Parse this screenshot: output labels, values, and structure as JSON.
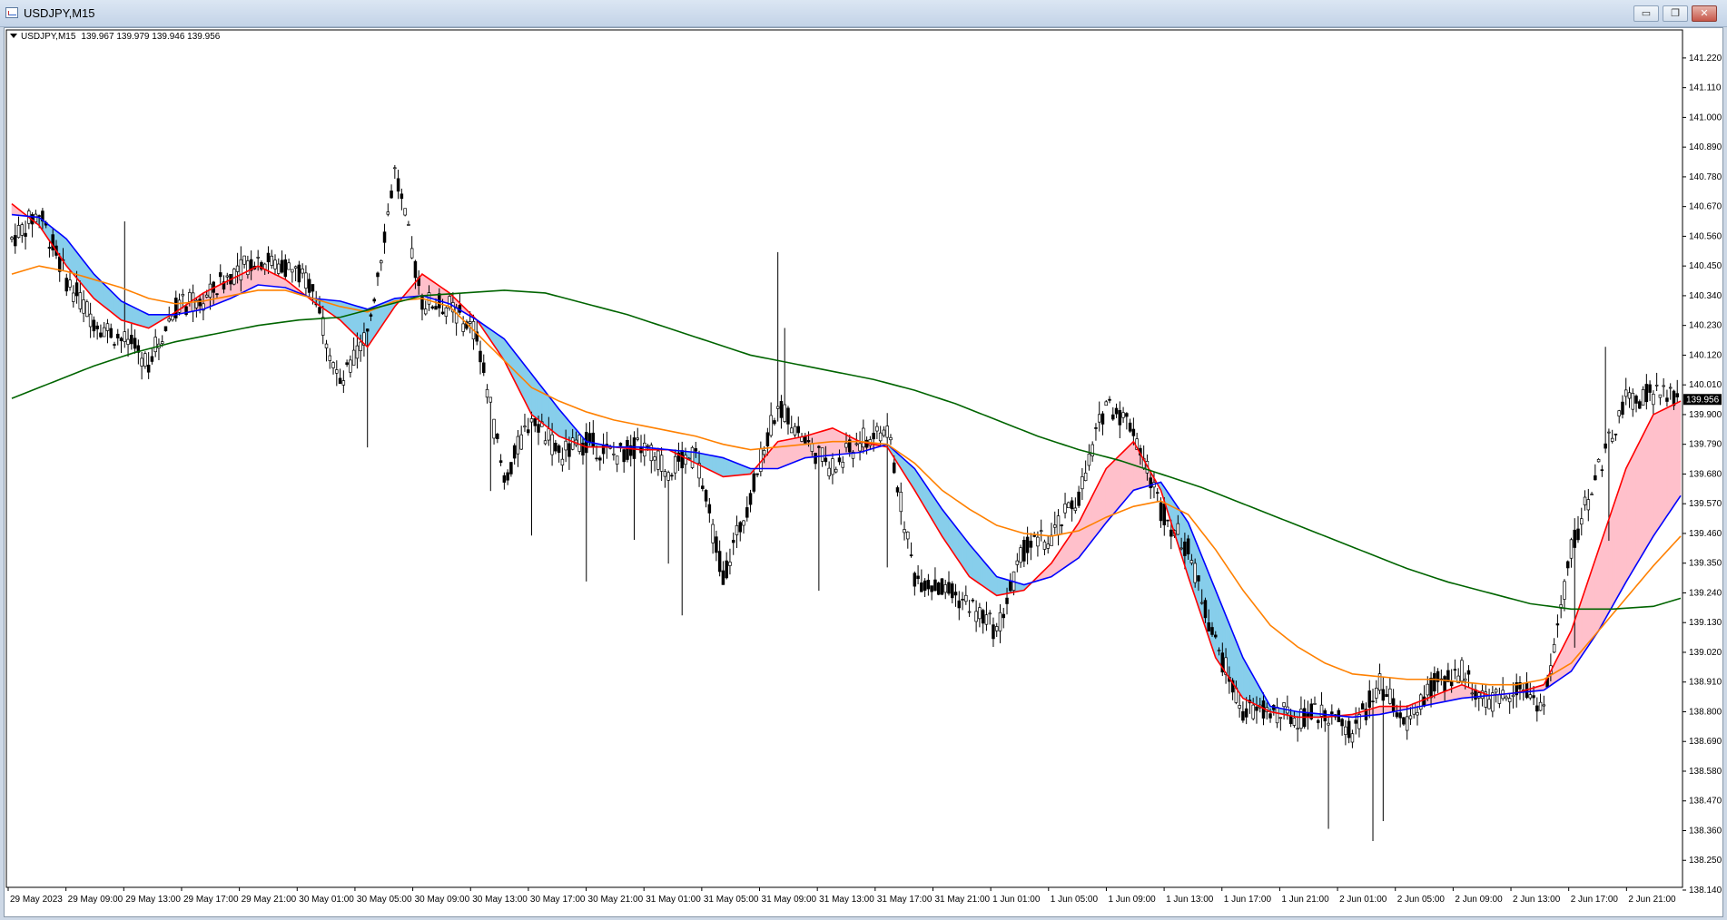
{
  "window": {
    "title": "USDJPY,M15"
  },
  "window_buttons": [
    {
      "name": "minimize-button",
      "glyph": "▭"
    },
    {
      "name": "restore-button",
      "glyph": "❐"
    },
    {
      "name": "close-button",
      "glyph": "✕"
    }
  ],
  "info": {
    "symbol": "USDJPY,M15",
    "ohlc": "139.967 139.979 139.946 139.956"
  },
  "colors": {
    "fast_ma": "#ff0000",
    "slow_ma": "#0000ff",
    "ma_orange": "#ff8000",
    "ma_green": "#006400",
    "bull_cloud": "#87ceeb",
    "bear_cloud": "#ffc0cb",
    "candles": "#000000"
  },
  "chart_data": {
    "type": "candlestick",
    "symbol": "USDJPY",
    "timeframe": "M15",
    "ylim": [
      138.14,
      141.27
    ],
    "y_ticks": [
      "141.220",
      "141.110",
      "141.000",
      "140.890",
      "140.780",
      "140.670",
      "140.560",
      "140.450",
      "140.340",
      "140.230",
      "140.120",
      "140.010",
      "139.900",
      "139.790",
      "139.680",
      "139.570",
      "139.460",
      "139.350",
      "139.240",
      "139.130",
      "139.020",
      "138.910",
      "138.800",
      "138.690",
      "138.580",
      "138.470",
      "138.360",
      "138.250",
      "138.140"
    ],
    "x_ticks": [
      "29 May 2023",
      "29 May 09:00",
      "29 May 13:00",
      "29 May 17:00",
      "29 May 21:00",
      "30 May 01:00",
      "30 May 05:00",
      "30 May 09:00",
      "30 May 13:00",
      "30 May 17:00",
      "30 May 21:00",
      "31 May 01:00",
      "31 May 05:00",
      "31 May 09:00",
      "31 May 13:00",
      "31 May 17:00",
      "31 May 21:00",
      "1 Jun 01:00",
      "1 Jun 05:00",
      "1 Jun 09:00",
      "1 Jun 13:00",
      "1 Jun 17:00",
      "1 Jun 21:00",
      "2 Jun 01:00",
      "2 Jun 05:00",
      "2 Jun 09:00",
      "2 Jun 13:00",
      "2 Jun 17:00",
      "2 Jun 21:00"
    ],
    "current_price": "139.956",
    "price_path": [
      [
        0,
        140.55
      ],
      [
        8,
        140.65
      ],
      [
        16,
        140.4
      ],
      [
        24,
        140.25
      ],
      [
        32,
        140.18
      ],
      [
        40,
        140.1
      ],
      [
        48,
        140.3
      ],
      [
        56,
        140.32
      ],
      [
        64,
        140.42
      ],
      [
        72,
        140.48
      ],
      [
        80,
        140.45
      ],
      [
        88,
        140.38
      ],
      [
        96,
        140.0
      ],
      [
        104,
        140.2
      ],
      [
        112,
        140.8
      ],
      [
        120,
        140.32
      ],
      [
        128,
        140.3
      ],
      [
        136,
        140.2
      ],
      [
        144,
        139.65
      ],
      [
        152,
        139.9
      ],
      [
        160,
        139.75
      ],
      [
        168,
        139.8
      ],
      [
        176,
        139.75
      ],
      [
        184,
        139.78
      ],
      [
        192,
        139.7
      ],
      [
        200,
        139.75
      ],
      [
        208,
        139.3
      ],
      [
        216,
        139.6
      ],
      [
        224,
        139.95
      ],
      [
        232,
        139.8
      ],
      [
        240,
        139.7
      ],
      [
        248,
        139.8
      ],
      [
        256,
        139.85
      ],
      [
        264,
        139.3
      ],
      [
        272,
        139.25
      ],
      [
        280,
        139.2
      ],
      [
        288,
        139.1
      ],
      [
        296,
        139.4
      ],
      [
        304,
        139.45
      ],
      [
        312,
        139.6
      ],
      [
        320,
        139.95
      ],
      [
        328,
        139.85
      ],
      [
        336,
        139.55
      ],
      [
        344,
        139.4
      ],
      [
        352,
        139.05
      ],
      [
        360,
        138.8
      ],
      [
        368,
        138.8
      ],
      [
        376,
        138.78
      ],
      [
        384,
        138.8
      ],
      [
        392,
        138.72
      ],
      [
        400,
        138.9
      ],
      [
        408,
        138.75
      ],
      [
        416,
        138.9
      ],
      [
        424,
        138.95
      ],
      [
        432,
        138.82
      ],
      [
        440,
        138.9
      ],
      [
        448,
        138.82
      ],
      [
        456,
        139.4
      ],
      [
        464,
        139.7
      ],
      [
        472,
        139.95
      ],
      [
        480,
        139.98
      ],
      [
        488,
        139.96
      ]
    ],
    "series": [
      {
        "name": "fast_ma",
        "color": "#ff0000",
        "values": [
          [
            0,
            140.68
          ],
          [
            8,
            140.6
          ],
          [
            16,
            140.45
          ],
          [
            24,
            140.33
          ],
          [
            32,
            140.25
          ],
          [
            40,
            140.22
          ],
          [
            48,
            140.28
          ],
          [
            56,
            140.35
          ],
          [
            64,
            140.4
          ],
          [
            72,
            140.45
          ],
          [
            80,
            140.4
          ],
          [
            88,
            140.32
          ],
          [
            96,
            140.25
          ],
          [
            104,
            140.15
          ],
          [
            112,
            140.3
          ],
          [
            120,
            140.42
          ],
          [
            128,
            140.35
          ],
          [
            136,
            140.25
          ],
          [
            144,
            140.1
          ],
          [
            152,
            139.9
          ],
          [
            160,
            139.82
          ],
          [
            168,
            139.78
          ],
          [
            176,
            139.78
          ],
          [
            184,
            139.77
          ],
          [
            192,
            139.77
          ],
          [
            200,
            139.72
          ],
          [
            208,
            139.67
          ],
          [
            216,
            139.68
          ],
          [
            224,
            139.8
          ],
          [
            232,
            139.82
          ],
          [
            240,
            139.85
          ],
          [
            248,
            139.8
          ],
          [
            256,
            139.78
          ],
          [
            264,
            139.62
          ],
          [
            272,
            139.45
          ],
          [
            280,
            139.3
          ],
          [
            288,
            139.23
          ],
          [
            296,
            139.25
          ],
          [
            304,
            139.35
          ],
          [
            312,
            139.5
          ],
          [
            320,
            139.7
          ],
          [
            328,
            139.8
          ],
          [
            336,
            139.62
          ],
          [
            344,
            139.3
          ],
          [
            352,
            139.0
          ],
          [
            360,
            138.85
          ],
          [
            368,
            138.8
          ],
          [
            376,
            138.78
          ],
          [
            384,
            138.78
          ],
          [
            392,
            138.79
          ],
          [
            400,
            138.82
          ],
          [
            408,
            138.82
          ],
          [
            416,
            138.86
          ],
          [
            424,
            138.9
          ],
          [
            432,
            138.86
          ],
          [
            440,
            138.87
          ],
          [
            448,
            138.9
          ],
          [
            456,
            139.1
          ],
          [
            464,
            139.4
          ],
          [
            472,
            139.7
          ],
          [
            480,
            139.9
          ],
          [
            488,
            139.95
          ]
        ]
      },
      {
        "name": "slow_ma",
        "color": "#0000ff",
        "values": [
          [
            0,
            140.64
          ],
          [
            8,
            140.63
          ],
          [
            16,
            140.55
          ],
          [
            24,
            140.42
          ],
          [
            32,
            140.32
          ],
          [
            40,
            140.27
          ],
          [
            48,
            140.27
          ],
          [
            56,
            140.29
          ],
          [
            64,
            140.33
          ],
          [
            72,
            140.38
          ],
          [
            80,
            140.37
          ],
          [
            88,
            140.33
          ],
          [
            96,
            140.32
          ],
          [
            104,
            140.29
          ],
          [
            112,
            140.33
          ],
          [
            120,
            140.34
          ],
          [
            128,
            140.31
          ],
          [
            136,
            140.25
          ],
          [
            144,
            140.18
          ],
          [
            152,
            140.05
          ],
          [
            160,
            139.92
          ],
          [
            168,
            139.8
          ],
          [
            176,
            139.78
          ],
          [
            184,
            139.78
          ],
          [
            192,
            139.77
          ],
          [
            200,
            139.76
          ],
          [
            208,
            139.74
          ],
          [
            216,
            139.7
          ],
          [
            224,
            139.7
          ],
          [
            232,
            139.74
          ],
          [
            240,
            139.75
          ],
          [
            248,
            139.76
          ],
          [
            256,
            139.79
          ],
          [
            264,
            139.7
          ],
          [
            272,
            139.55
          ],
          [
            280,
            139.42
          ],
          [
            288,
            139.3
          ],
          [
            296,
            139.27
          ],
          [
            304,
            139.3
          ],
          [
            312,
            139.37
          ],
          [
            320,
            139.5
          ],
          [
            328,
            139.62
          ],
          [
            336,
            139.65
          ],
          [
            344,
            139.5
          ],
          [
            352,
            139.25
          ],
          [
            360,
            139.0
          ],
          [
            368,
            138.82
          ],
          [
            376,
            138.8
          ],
          [
            384,
            138.79
          ],
          [
            392,
            138.78
          ],
          [
            400,
            138.79
          ],
          [
            408,
            138.81
          ],
          [
            416,
            138.83
          ],
          [
            424,
            138.85
          ],
          [
            432,
            138.86
          ],
          [
            440,
            138.87
          ],
          [
            448,
            138.88
          ],
          [
            456,
            138.95
          ],
          [
            464,
            139.1
          ],
          [
            472,
            139.28
          ],
          [
            480,
            139.45
          ],
          [
            488,
            139.6
          ]
        ]
      },
      {
        "name": "ma_orange",
        "color": "#ff8000",
        "values": [
          [
            0,
            140.42
          ],
          [
            8,
            140.45
          ],
          [
            16,
            140.43
          ],
          [
            24,
            140.4
          ],
          [
            32,
            140.37
          ],
          [
            40,
            140.33
          ],
          [
            48,
            140.31
          ],
          [
            56,
            140.32
          ],
          [
            64,
            140.34
          ],
          [
            72,
            140.36
          ],
          [
            80,
            140.36
          ],
          [
            88,
            140.33
          ],
          [
            96,
            140.3
          ],
          [
            104,
            140.28
          ],
          [
            112,
            140.32
          ],
          [
            120,
            140.33
          ],
          [
            128,
            140.3
          ],
          [
            136,
            140.2
          ],
          [
            144,
            140.1
          ],
          [
            152,
            140.0
          ],
          [
            160,
            139.95
          ],
          [
            168,
            139.91
          ],
          [
            176,
            139.88
          ],
          [
            184,
            139.86
          ],
          [
            192,
            139.84
          ],
          [
            200,
            139.82
          ],
          [
            208,
            139.79
          ],
          [
            216,
            139.77
          ],
          [
            224,
            139.78
          ],
          [
            232,
            139.79
          ],
          [
            240,
            139.8
          ],
          [
            248,
            139.8
          ],
          [
            256,
            139.79
          ],
          [
            264,
            139.72
          ],
          [
            272,
            139.62
          ],
          [
            280,
            139.55
          ],
          [
            288,
            139.49
          ],
          [
            296,
            139.46
          ],
          [
            304,
            139.45
          ],
          [
            312,
            139.47
          ],
          [
            320,
            139.52
          ],
          [
            328,
            139.56
          ],
          [
            336,
            139.58
          ],
          [
            344,
            139.53
          ],
          [
            352,
            139.4
          ],
          [
            360,
            139.25
          ],
          [
            368,
            139.12
          ],
          [
            376,
            139.04
          ],
          [
            384,
            138.98
          ],
          [
            392,
            138.94
          ],
          [
            400,
            138.93
          ],
          [
            408,
            138.92
          ],
          [
            416,
            138.92
          ],
          [
            424,
            138.91
          ],
          [
            432,
            138.9
          ],
          [
            440,
            138.9
          ],
          [
            448,
            138.92
          ],
          [
            456,
            138.98
          ],
          [
            464,
            139.1
          ],
          [
            472,
            139.22
          ],
          [
            480,
            139.34
          ],
          [
            488,
            139.45
          ]
        ]
      },
      {
        "name": "ma_green",
        "color": "#006400",
        "values": [
          [
            0,
            139.96
          ],
          [
            12,
            140.02
          ],
          [
            24,
            140.08
          ],
          [
            36,
            140.13
          ],
          [
            48,
            140.17
          ],
          [
            60,
            140.2
          ],
          [
            72,
            140.23
          ],
          [
            84,
            140.25
          ],
          [
            96,
            140.26
          ],
          [
            108,
            140.3
          ],
          [
            120,
            140.34
          ],
          [
            132,
            140.35
          ],
          [
            144,
            140.36
          ],
          [
            156,
            140.35
          ],
          [
            168,
            140.31
          ],
          [
            180,
            140.27
          ],
          [
            192,
            140.22
          ],
          [
            204,
            140.17
          ],
          [
            216,
            140.12
          ],
          [
            228,
            140.09
          ],
          [
            240,
            140.06
          ],
          [
            252,
            140.03
          ],
          [
            264,
            139.99
          ],
          [
            276,
            139.94
          ],
          [
            288,
            139.88
          ],
          [
            300,
            139.82
          ],
          [
            312,
            139.77
          ],
          [
            324,
            139.73
          ],
          [
            336,
            139.68
          ],
          [
            348,
            139.63
          ],
          [
            360,
            139.57
          ],
          [
            372,
            139.51
          ],
          [
            384,
            139.45
          ],
          [
            396,
            139.39
          ],
          [
            408,
            139.33
          ],
          [
            420,
            139.28
          ],
          [
            432,
            139.24
          ],
          [
            444,
            139.2
          ],
          [
            456,
            139.18
          ],
          [
            468,
            139.18
          ],
          [
            480,
            139.19
          ],
          [
            488,
            139.22
          ]
        ]
      }
    ]
  }
}
